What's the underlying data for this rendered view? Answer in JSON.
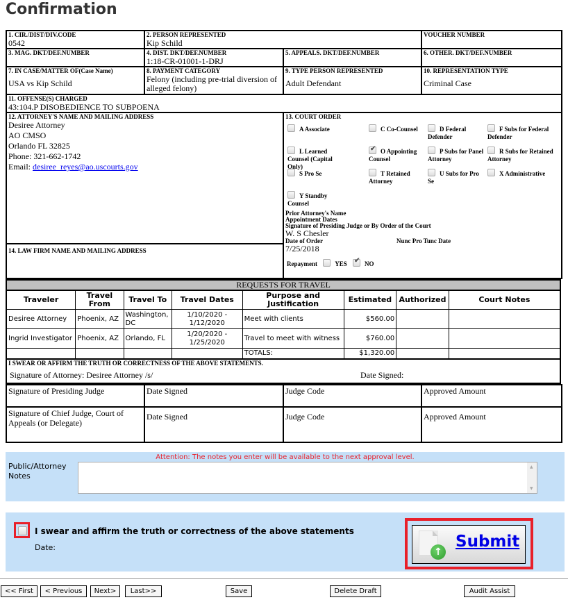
{
  "page": {
    "title": "Confirmation"
  },
  "form": {
    "row1": {
      "cir_label": "1. CIR./DIST/DIV.CODE",
      "cir_value": "0542",
      "person_label": "2. PERSON REPRESENTED",
      "person_value": "Kip Schild",
      "voucher_label": "VOUCHER NUMBER",
      "voucher_value": ""
    },
    "row2": {
      "mag_label": "3. MAG. DKT/DEF.NUMBER",
      "mag_value": "",
      "dist_label": "4. DIST. DKT/DEF.NUMBER",
      "dist_value": "1:18-CR-01001-1-DRJ",
      "appeals_label": "5. APPEALS. DKT/DEF.NUMBER",
      "appeals_value": "",
      "other_label": "6. OTHER. DKT/DEF.NUMBER",
      "other_value": ""
    },
    "row3": {
      "case_label": "7. IN CASE/MATTER OF",
      "case_label_sub": "(Case Name)",
      "case_value": "USA vs Kip Schild",
      "payment_label": "8. PAYMENT CATEGORY",
      "payment_value": "Felony (including pre-trial diversion of alleged felony)",
      "type_label": "9. TYPE PERSON REPRESENTED",
      "type_value": "Adult Defendant",
      "rep_label": "10. REPRESENTATION TYPE",
      "rep_value": "Criminal Case"
    },
    "offense": {
      "label": "11. OFFENSE(S) CHARGED",
      "value": "43:104.P DISOBEDIENCE TO SUBPOENA"
    },
    "attorney": {
      "label": "12. ATTORNEY'S NAME AND MAILING ADDRESS",
      "name": "Desiree Attorney",
      "org": "AO CMSO",
      "city": "Orlando FL 32825",
      "phone": "Phone: 321-662-1742",
      "email_label": "Email: ",
      "email": "desiree_reyes@ao.uscourts.gov"
    },
    "law_firm": {
      "label": "14. LAW FIRM NAME AND MAILING ADDRESS",
      "value": ""
    },
    "court_order": {
      "label": "13. COURT ORDER",
      "options": [
        {
          "code": "A Associate",
          "checked": false
        },
        {
          "code": "C Co-Counsel",
          "checked": false
        },
        {
          "code": "D Federal Defender",
          "checked": false
        },
        {
          "code": "F Subs for Federal Defender",
          "checked": false
        },
        {
          "code": "L Learned Counsel (Capital Only)",
          "checked": false
        },
        {
          "code": "O Appointing Counsel",
          "checked": true
        },
        {
          "code": "P Subs for Panel Attorney",
          "checked": false
        },
        {
          "code": "R Subs for Retained Attorney",
          "checked": false
        },
        {
          "code": "S Pro Se",
          "checked": false
        },
        {
          "code": "T Retained Attorney",
          "checked": false
        },
        {
          "code": "U Subs for Pro Se",
          "checked": false
        },
        {
          "code": "X Administrative",
          "checked": false
        },
        {
          "code": "Y Standby Counsel",
          "checked": false
        }
      ],
      "prior_attorney_label": "Prior Attorney's Name",
      "appointment_dates_label": "Appointment Dates",
      "signature_label": "Signature of Presiding Judge or By Order of the Court",
      "signature_value": "W. S Chesler",
      "date_of_order_label": "Date of Order",
      "date_of_order_value": "7/25/2018",
      "nunc_label": "Nunc Pro Tunc Date",
      "repayment_label": "Repayment",
      "repayment_yes_label": "YES",
      "repayment_no_label": "NO",
      "repayment_yes": false,
      "repayment_no": true
    }
  },
  "travel": {
    "title": "REQUESTS FOR TRAVEL",
    "headers": [
      "Traveler",
      "Travel From",
      "Travel To",
      "Travel Dates",
      "Purpose and Justification",
      "Estimated",
      "Authorized",
      "Court Notes"
    ],
    "rows": [
      {
        "traveler": "Desiree Attorney",
        "from": "Phoenix, AZ",
        "to": "Washington, DC",
        "dates": "1/10/2020 - 1/12/2020",
        "purpose": "Meet with clients",
        "estimated": "$560.00",
        "authorized": "",
        "notes": ""
      },
      {
        "traveler": "Ingrid Investigator",
        "from": "Phoenix, AZ",
        "to": "Orlando, FL",
        "dates": "1/20/2020 - 1/25/2020",
        "purpose": "Travel to meet with witness",
        "estimated": "$760.00",
        "authorized": "",
        "notes": ""
      }
    ],
    "totals_label": "TOTALS:",
    "totals_estimated": "$1,320.00"
  },
  "signatures": {
    "oath": "I SWEAR OR AFFIRM THE TRUTH OR CORRECTNESS OF THE ABOVE STATEMENTS.",
    "attorney_signature": "Signature of Attorney: Desiree Attorney /s/",
    "date_signed": "Date Signed:",
    "presiding_judge": "Signature of Presiding Judge",
    "chief_judge": "Signature of Chief Judge, Court of Appeals (or Delegate)",
    "date_signed_label": "Date Signed",
    "judge_code_label": "Judge Code",
    "approved_amount_label": "Approved Amount"
  },
  "notes": {
    "attention": "Attention: The notes you enter will be available to the next approval level.",
    "label": "Public/Attorney Notes",
    "value": ""
  },
  "affirm": {
    "text": "I swear and affirm the truth or correctness of the above statements",
    "checked": false,
    "date_label": "Date:"
  },
  "submit": {
    "label": "Submit"
  },
  "nav": {
    "first": "<< First",
    "previous": "< Previous",
    "next": "Next>",
    "last": "Last>>",
    "save": "Save",
    "delete_draft": "Delete Draft",
    "audit_assist": "Audit Assist"
  },
  "colors": {
    "panel_bg": "#c5e0f8",
    "highlight": "#e8202a",
    "attention": "#e8202a",
    "link": "#0000e6",
    "section_header_bg": "#c0c0c0"
  }
}
